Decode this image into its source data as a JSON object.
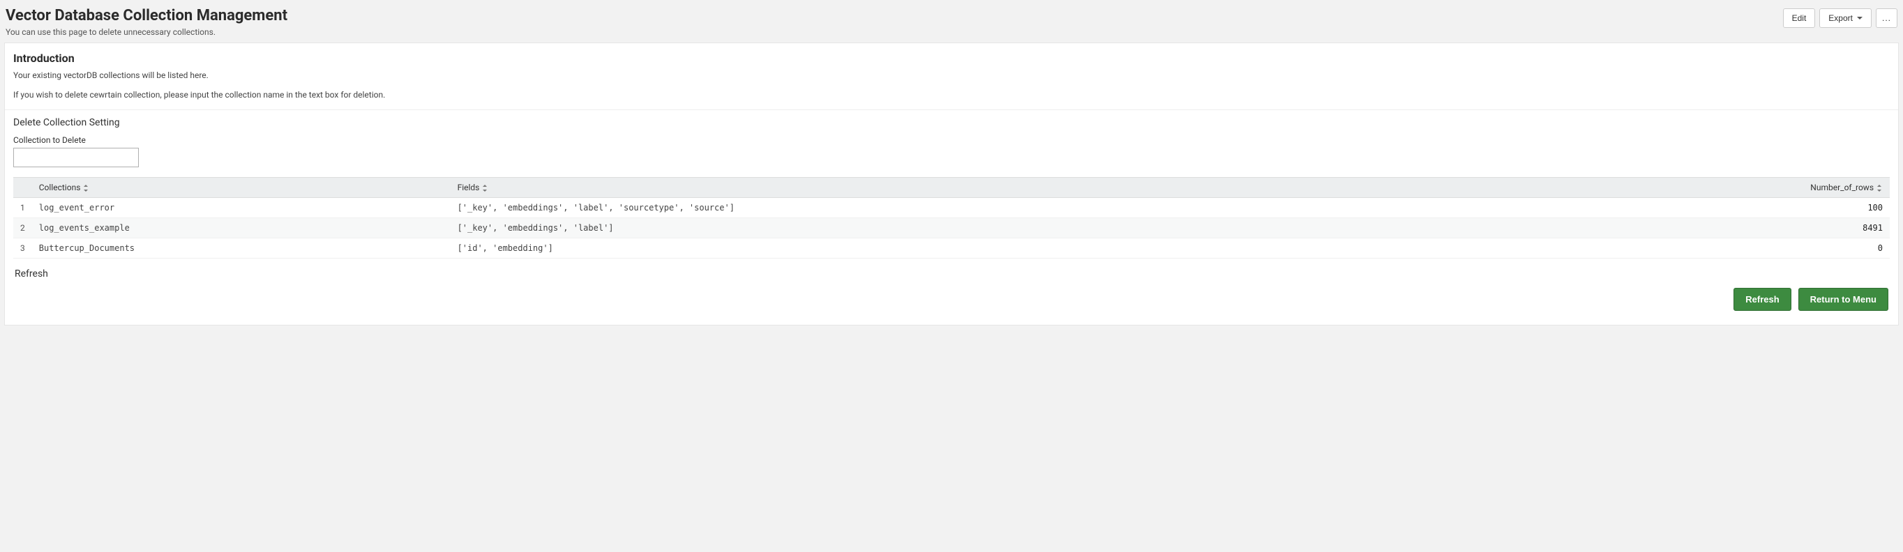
{
  "header": {
    "title": "Vector Database Collection Management",
    "subtitle": "You can use this page to delete unnecessary collections.",
    "actions": {
      "edit_label": "Edit",
      "export_label": "Export",
      "more_label": "..."
    }
  },
  "intro": {
    "heading": "Introduction",
    "line1": "Your existing vectorDB collections will be listed here.",
    "line2": "If you wish to delete cewrtain collection, please input the collection name in the text box for deletion."
  },
  "delete_panel": {
    "title": "Delete Collection Setting",
    "field_label": "Collection to Delete",
    "value": ""
  },
  "table": {
    "columns": {
      "collections": "Collections",
      "fields": "Fields",
      "rows": "Number_of_rows"
    },
    "rows": [
      {
        "n": "1",
        "collection": "log_event_error",
        "fields": "['_key', 'embeddings', 'label', 'sourcetype', 'source']",
        "count": "100"
      },
      {
        "n": "2",
        "collection": "log_events_example",
        "fields": "['_key', 'embeddings', 'label']",
        "count": "8491"
      },
      {
        "n": "3",
        "collection": "Buttercup_Documents",
        "fields": "['id', 'embedding']",
        "count": "0"
      }
    ]
  },
  "refresh_section_label": "Refresh",
  "footer": {
    "refresh_label": "Refresh",
    "return_label": "Return to Menu"
  }
}
